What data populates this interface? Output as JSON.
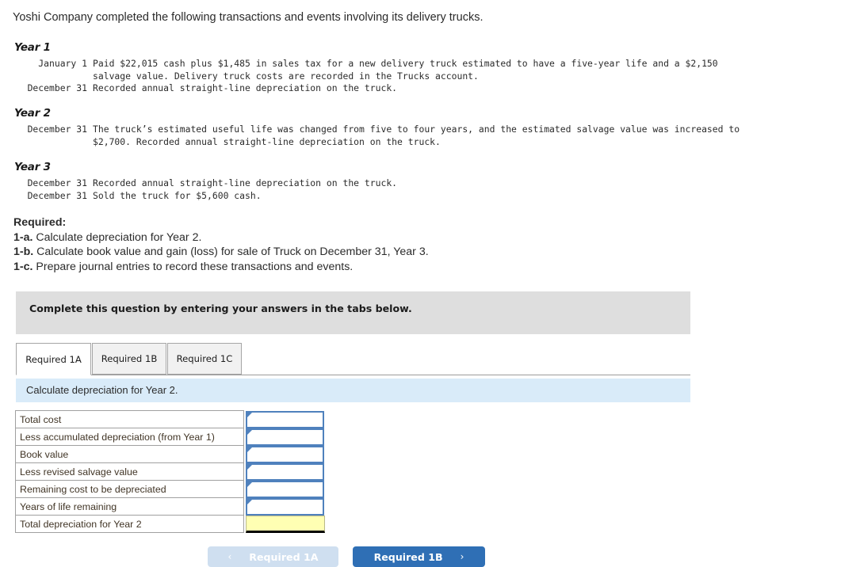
{
  "intro": "Yoshi Company completed the following transactions and events involving its delivery trucks.",
  "years": [
    {
      "title": "Year 1",
      "events": [
        {
          "date": "January 1",
          "lines": [
            "Paid $22,015 cash plus $1,485 in sales tax for a new delivery truck estimated to have a five-year life and a $2,150",
            "salvage value. Delivery truck costs are recorded in the Trucks account."
          ]
        },
        {
          "date": "December 31",
          "lines": [
            "Recorded annual straight-line depreciation on the truck."
          ]
        }
      ]
    },
    {
      "title": "Year 2",
      "events": [
        {
          "date": "December 31",
          "lines": [
            "The truck’s estimated useful life was changed from five to four years, and the estimated salvage value was increased to",
            "$2,700. Recorded annual straight-line depreciation on the truck."
          ]
        }
      ]
    },
    {
      "title": "Year 3",
      "events": [
        {
          "date": "December 31",
          "lines": [
            "Recorded annual straight-line depreciation on the truck."
          ]
        },
        {
          "date": "December 31",
          "lines": [
            "Sold the truck for $5,600 cash."
          ]
        }
      ]
    }
  ],
  "required": {
    "heading": "Required:",
    "items": [
      {
        "num": "1-a.",
        "text": " Calculate depreciation for Year 2."
      },
      {
        "num": "1-b.",
        "text": " Calculate book value and gain (loss) for sale of Truck on December 31, Year 3."
      },
      {
        "num": "1-c.",
        "text": " Prepare journal entries to record these transactions and events."
      }
    ]
  },
  "banner": {
    "text": "Complete this question by entering your answers in the tabs below."
  },
  "tabs": [
    {
      "label": "Required 1A",
      "active": true
    },
    {
      "label": "Required 1B",
      "active": false
    },
    {
      "label": "Required 1C",
      "active": false
    }
  ],
  "subbar": {
    "text": "Calculate depreciation for Year 2."
  },
  "answer_table": {
    "rows": [
      {
        "label": "Total cost",
        "value": "",
        "style": "input"
      },
      {
        "label": "Less accumulated depreciation (from Year 1)",
        "value": "",
        "style": "input"
      },
      {
        "label": "Book value",
        "value": "",
        "style": "input"
      },
      {
        "label": "Less revised salvage value",
        "value": "",
        "style": "input"
      },
      {
        "label": "Remaining cost to be depreciated",
        "value": "",
        "style": "input"
      },
      {
        "label": "Years of life remaining",
        "value": "",
        "style": "input"
      },
      {
        "label": "Total depreciation for Year 2",
        "value": "",
        "style": "yellow"
      }
    ]
  },
  "nav": {
    "prev": {
      "label": "Required 1A",
      "chevron": "‹",
      "disabled": true
    },
    "next": {
      "label": "Required 1B",
      "chevron": "›",
      "disabled": false
    }
  },
  "colors": {
    "banner_gray": "#dedede",
    "subbar_blue": "#d9ebf9",
    "input_border": "#4f81bd",
    "yellow_cell": "#ffffb3",
    "next_button": "#2f6fb5",
    "prev_button": "#cfdff0"
  }
}
